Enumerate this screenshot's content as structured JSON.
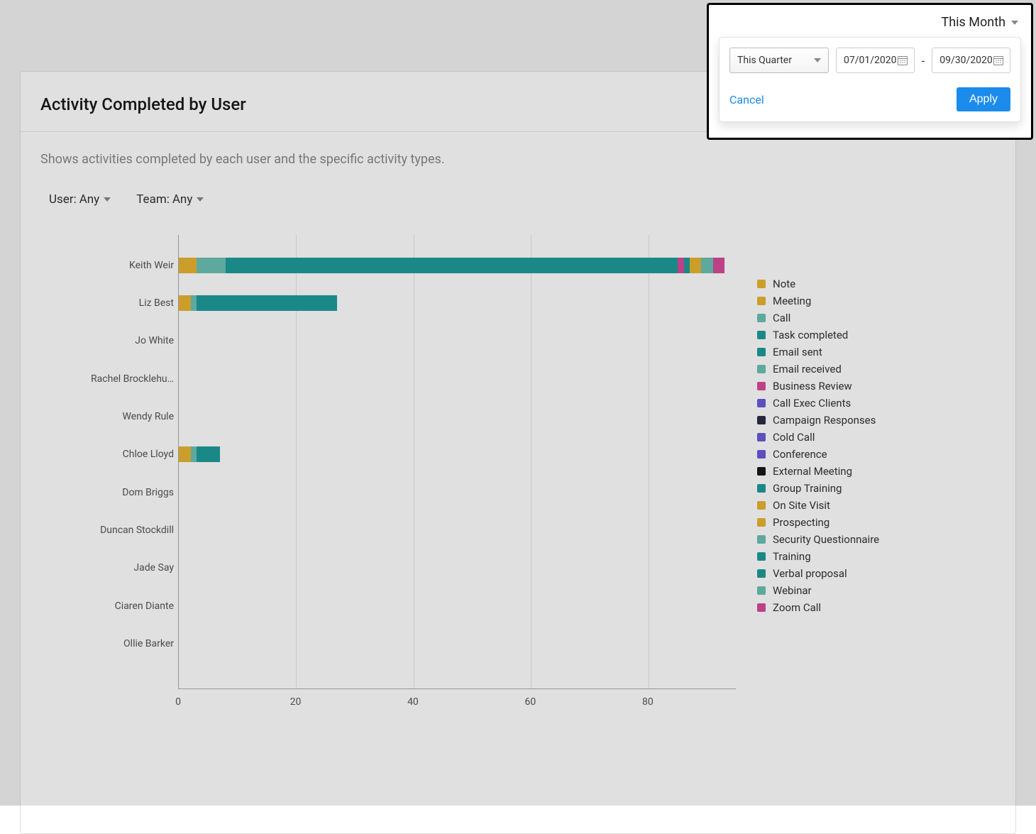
{
  "card": {
    "title": "Activity Completed by User",
    "description": "Shows activities completed by each user and the specific activity types."
  },
  "filters": {
    "user_label": "User:",
    "user_value": "Any",
    "team_label": "Team:",
    "team_value": "Any"
  },
  "date_popover": {
    "header_label": "This Month",
    "preset_selected": "This Quarter",
    "start_date": "07/01/2020",
    "end_date": "09/30/2020",
    "cancel_label": "Cancel",
    "apply_label": "Apply"
  },
  "chart_data": {
    "type": "bar",
    "orientation": "horizontal",
    "xlabel": "",
    "ylabel": "",
    "xlim": [
      0,
      95
    ],
    "x_ticks": [
      0,
      20,
      40,
      60,
      80
    ],
    "categories": [
      "Keith Weir",
      "Liz Best",
      "Jo White",
      "Rachel Brocklehu…",
      "Wendy Rule",
      "Chloe Lloyd",
      "Dom Briggs",
      "Duncan Stockdill",
      "Jade Say",
      "Ciaren Diante",
      "Ollie Barker"
    ],
    "legend": [
      {
        "name": "Note",
        "color": "#e8b431"
      },
      {
        "name": "Meeting",
        "color": "#e8b431"
      },
      {
        "name": "Call",
        "color": "#6bc1b3"
      },
      {
        "name": "Task completed",
        "color": "#1f9b9b"
      },
      {
        "name": "Email sent",
        "color": "#1f9b9b"
      },
      {
        "name": "Email received",
        "color": "#6bc1b3"
      },
      {
        "name": "Business Review",
        "color": "#d64a9a"
      },
      {
        "name": "Call Exec Clients",
        "color": "#6a5ad8"
      },
      {
        "name": "Campaign Responses",
        "color": "#2b2d42"
      },
      {
        "name": "Cold Call",
        "color": "#6a5ad8"
      },
      {
        "name": "Conference",
        "color": "#6a5ad8"
      },
      {
        "name": "External Meeting",
        "color": "#1a1a1a"
      },
      {
        "name": "Group Training",
        "color": "#1f9b9b"
      },
      {
        "name": "On Site Visit",
        "color": "#e8b431"
      },
      {
        "name": "Prospecting",
        "color": "#e8b431"
      },
      {
        "name": "Security Questionnaire",
        "color": "#6bc1b3"
      },
      {
        "name": "Training",
        "color": "#1f9b9b"
      },
      {
        "name": "Verbal proposal",
        "color": "#1f9b9b"
      },
      {
        "name": "Webinar",
        "color": "#6bc1b3"
      },
      {
        "name": "Zoom Call",
        "color": "#d64a9a"
      }
    ],
    "series_stacked": [
      {
        "category": "Keith Weir",
        "segments": [
          {
            "name": "Note",
            "value": 3,
            "color": "#e8b431"
          },
          {
            "name": "Call",
            "value": 5,
            "color": "#6bc1b3"
          },
          {
            "name": "Task completed",
            "value": 77,
            "color": "#1f9b9b"
          },
          {
            "name": "Business Review",
            "value": 1,
            "color": "#d64a9a"
          },
          {
            "name": "Training",
            "value": 1,
            "color": "#1f9b9b"
          },
          {
            "name": "On Site Visit",
            "value": 1,
            "color": "#e8b431"
          },
          {
            "name": "Prospecting",
            "value": 1,
            "color": "#e8b431"
          },
          {
            "name": "Security Questionnaire",
            "value": 1,
            "color": "#6bc1b3"
          },
          {
            "name": "Webinar",
            "value": 1,
            "color": "#6bc1b3"
          },
          {
            "name": "Zoom Call",
            "value": 2,
            "color": "#d64a9a"
          }
        ]
      },
      {
        "category": "Liz Best",
        "segments": [
          {
            "name": "Note",
            "value": 2,
            "color": "#e8b431"
          },
          {
            "name": "Call",
            "value": 1,
            "color": "#6bc1b3"
          },
          {
            "name": "Task completed",
            "value": 24,
            "color": "#1f9b9b"
          }
        ]
      },
      {
        "category": "Jo White",
        "segments": []
      },
      {
        "category": "Rachel Brocklehu…",
        "segments": []
      },
      {
        "category": "Wendy Rule",
        "segments": []
      },
      {
        "category": "Chloe Lloyd",
        "segments": [
          {
            "name": "Note",
            "value": 2,
            "color": "#e8b431"
          },
          {
            "name": "Call",
            "value": 1,
            "color": "#6bc1b3"
          },
          {
            "name": "Task completed",
            "value": 4,
            "color": "#1f9b9b"
          }
        ]
      },
      {
        "category": "Dom Briggs",
        "segments": []
      },
      {
        "category": "Duncan Stockdill",
        "segments": []
      },
      {
        "category": "Jade Say",
        "segments": []
      },
      {
        "category": "Ciaren Diante",
        "segments": []
      },
      {
        "category": "Ollie Barker",
        "segments": []
      }
    ]
  }
}
